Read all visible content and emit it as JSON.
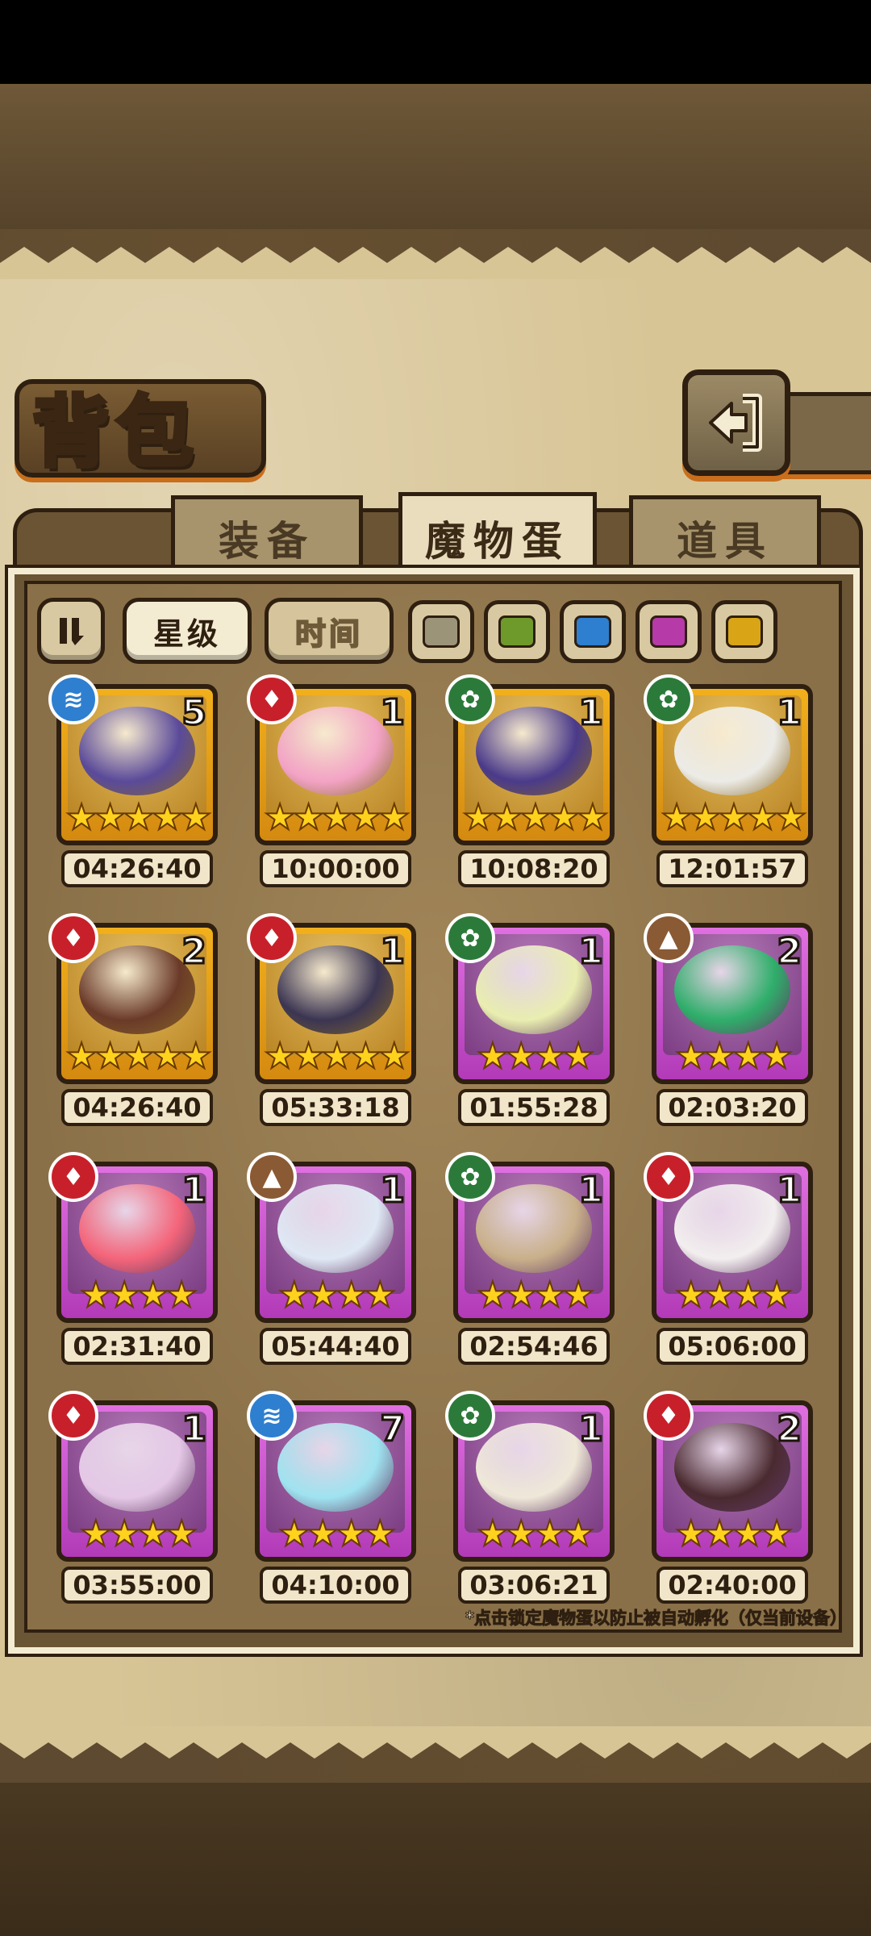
{
  "header": {
    "title": "背包"
  },
  "tabs": [
    {
      "label": "装备",
      "active": false
    },
    {
      "label": "魔物蛋",
      "active": true
    },
    {
      "label": "道具",
      "active": false
    }
  ],
  "filters": {
    "star_label": "星级",
    "time_label": "时间",
    "color_chips": [
      "#9c9478",
      "#6e9a2c",
      "#2e7fd0",
      "#b63aa8",
      "#d9a516"
    ]
  },
  "eggs": [
    {
      "element": "water",
      "count": "5",
      "stars": "★★★★★",
      "time": "04:26:40",
      "rarity": "gold",
      "color": "#5a4a9a"
    },
    {
      "element": "fire",
      "count": "1",
      "stars": "★★★★★",
      "time": "10:00:00",
      "rarity": "gold",
      "color": "#f3a3c5"
    },
    {
      "element": "wood",
      "count": "1",
      "stars": "★★★★★",
      "time": "10:08:20",
      "rarity": "gold",
      "color": "#4a3a8a"
    },
    {
      "element": "wood",
      "count": "1",
      "stars": "★★★★★",
      "time": "12:01:57",
      "rarity": "gold",
      "color": "#ecebe6"
    },
    {
      "element": "fire",
      "count": "2",
      "stars": "★★★★★",
      "time": "04:26:40",
      "rarity": "gold",
      "color": "#6a3a28"
    },
    {
      "element": "fire",
      "count": "1",
      "stars": "★★★★★",
      "time": "05:33:18",
      "rarity": "gold",
      "color": "#3b3552"
    },
    {
      "element": "wood",
      "count": "1",
      "stars": "★★★★",
      "time": "01:55:28",
      "rarity": "purple",
      "color": "#e9eeb0"
    },
    {
      "element": "earth",
      "count": "2",
      "stars": "★★★★",
      "time": "02:03:20",
      "rarity": "purple",
      "color": "#2fae6a"
    },
    {
      "element": "fire",
      "count": "1",
      "stars": "★★★★",
      "time": "02:31:40",
      "rarity": "purple",
      "color": "#f4657a"
    },
    {
      "element": "earth",
      "count": "1",
      "stars": "★★★★",
      "time": "05:44:40",
      "rarity": "purple",
      "color": "#dfe8f4"
    },
    {
      "element": "wood",
      "count": "1",
      "stars": "★★★★",
      "time": "02:54:46",
      "rarity": "purple",
      "color": "#c9b08a"
    },
    {
      "element": "fire",
      "count": "1",
      "stars": "★★★★",
      "time": "05:06:00",
      "rarity": "purple",
      "color": "#f2eeee"
    },
    {
      "element": "fire",
      "count": "1",
      "stars": "★★★★",
      "time": "03:55:00",
      "rarity": "purple",
      "color": "#e4c8e6"
    },
    {
      "element": "water",
      "count": "7",
      "stars": "★★★★",
      "time": "04:10:00",
      "rarity": "purple",
      "color": "#9fe3f0"
    },
    {
      "element": "wood",
      "count": "1",
      "stars": "★★★★",
      "time": "03:06:21",
      "rarity": "purple",
      "color": "#efe8d8"
    },
    {
      "element": "fire",
      "count": "2",
      "stars": "★★★★",
      "time": "02:40:00",
      "rarity": "purple",
      "color": "#4a2a30"
    }
  ],
  "footer_note": "*点击锁定魔物蛋以防止被自动孵化（仅当前设备）"
}
